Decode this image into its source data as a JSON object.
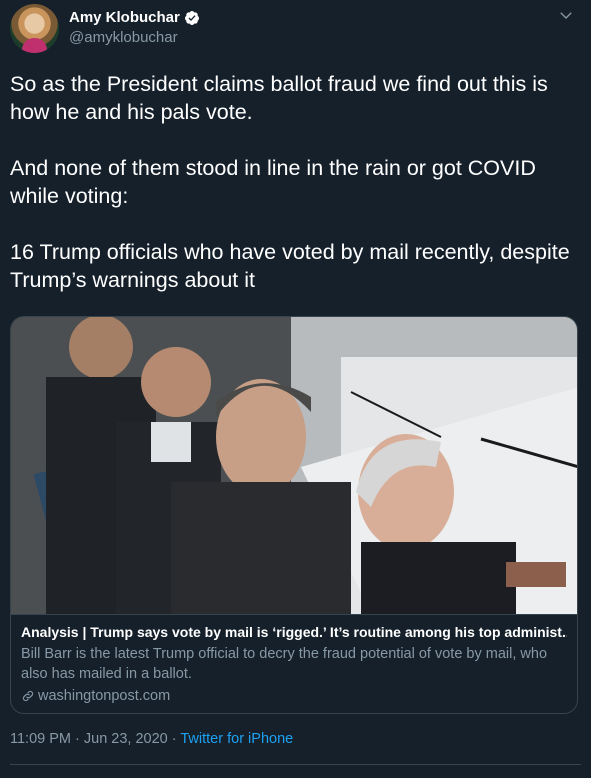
{
  "author": {
    "display_name": "Amy Klobuchar",
    "handle": "@amyklobuchar",
    "verified": true
  },
  "tweet": {
    "text": "So as the President claims ballot fraud we find out this is how he and his pals vote.\n\nAnd none of them stood in line in the rain or got COVID while voting:\n\n16 Trump officials who have voted by mail recently, despite Trump’s warnings about it"
  },
  "card": {
    "title": "Analysis | Trump says vote by mail is ‘rigged.’ It’s routine among his top administ...",
    "description": "Bill Barr is the latest Trump official to decry the fraud potential of vote by mail, who also has mailed in a ballot.",
    "domain": "washingtonpost.com"
  },
  "meta": {
    "time": "11:09 PM",
    "separator": " · ",
    "date": "Jun 23, 2020",
    "source": "Twitter for iPhone"
  },
  "colors": {
    "background": "#15202b",
    "secondary_text": "#8899a6",
    "accent": "#1da1f2",
    "border": "#38444d"
  }
}
